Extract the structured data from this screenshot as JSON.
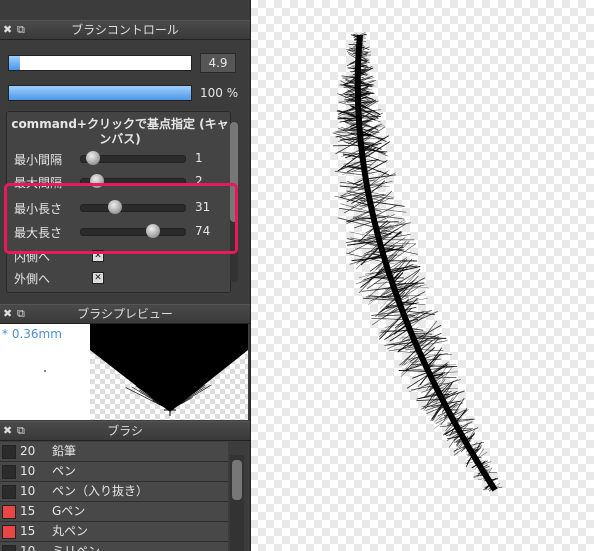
{
  "brush_control": {
    "title": "ブラシコントロール",
    "size_value": "4.9",
    "size_fraction": 0.06,
    "opacity_value": "100 %",
    "opacity_fraction": 1.0,
    "heading": "command+クリックで基点指定 (キャンバス)",
    "rows": [
      {
        "label": "最小間隔",
        "value": "1",
        "fraction": 0.05
      },
      {
        "label": "最大間隔",
        "value": "2",
        "fraction": 0.1
      },
      {
        "label": "最小長さ",
        "value": "31",
        "fraction": 0.3
      },
      {
        "label": "最大長さ",
        "value": "74",
        "fraction": 0.72
      }
    ],
    "checkboxes": [
      {
        "label": "内側へ",
        "checked": true
      },
      {
        "label": "外側へ",
        "checked": true
      }
    ]
  },
  "brush_preview": {
    "title": "ブラシプレビュー",
    "size_label": "* 0.36mm"
  },
  "brush_list": {
    "title": "ブラシ",
    "items": [
      {
        "size": "20",
        "name": "鉛筆",
        "color": "#2b2b2b"
      },
      {
        "size": "10",
        "name": "ペン",
        "color": "#2b2b2b"
      },
      {
        "size": "10",
        "name": "ペン（入り抜き）",
        "color": "#2b2b2b"
      },
      {
        "size": "15",
        "name": "Gペン",
        "color": "#e84545"
      },
      {
        "size": "15",
        "name": "丸ペン",
        "color": "#e84545"
      },
      {
        "size": "10",
        "name": "ミリペン",
        "color": "#2b2b2b"
      }
    ]
  },
  "icons": {
    "close": "✖",
    "popout": "⧉"
  },
  "colors": {
    "highlight": "#e8195c",
    "accent": "#4d97e8"
  }
}
